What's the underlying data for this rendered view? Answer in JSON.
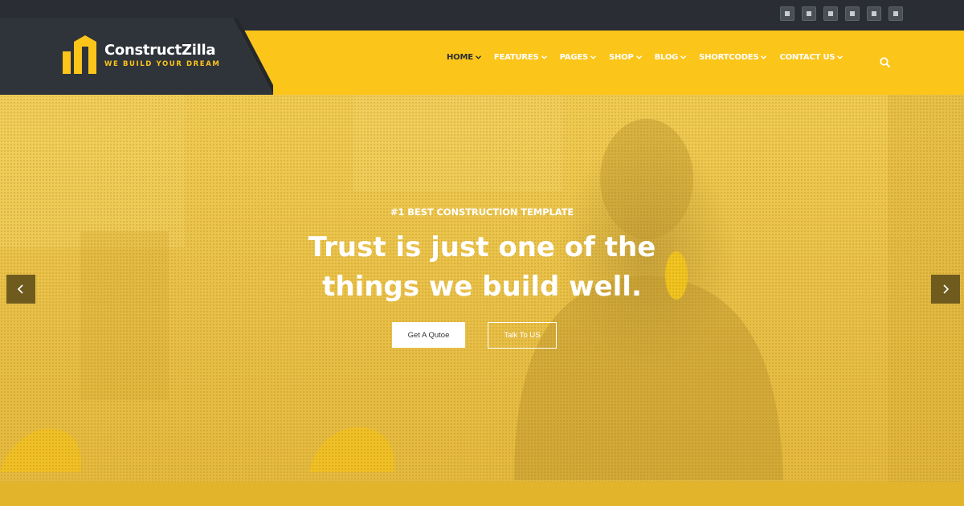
{
  "topbar": {
    "social_icons": [
      "social-icon-1",
      "social-icon-2",
      "social-icon-3",
      "social-icon-4",
      "social-icon-5",
      "social-icon-6"
    ]
  },
  "brand": {
    "name": "ConstructZilla",
    "tagline": "WE BUILD YOUR DREAM"
  },
  "nav": {
    "items": [
      {
        "label": "HOME",
        "active": true
      },
      {
        "label": "FEATURES"
      },
      {
        "label": "PAGES"
      },
      {
        "label": "SHOP"
      },
      {
        "label": "BLOG"
      },
      {
        "label": "SHORTCODES"
      },
      {
        "label": "CONTACT US"
      }
    ],
    "search_icon": "search-icon"
  },
  "hero": {
    "kicker": "#1 BEST CONSTRUCTION TEMPLATE",
    "headline_line1": "Trust is just one of the",
    "headline_line2": "things we build well.",
    "primary_button": "Get A Qutoe",
    "secondary_button": "Talk To US",
    "prev_icon": "chevron-left-icon",
    "next_icon": "chevron-right-icon"
  },
  "colors": {
    "brand_yellow": "#fcc51a",
    "dark": "#2a2e34",
    "hero_overlay": "#e9c149",
    "footer_strip": "#e1b42c"
  }
}
